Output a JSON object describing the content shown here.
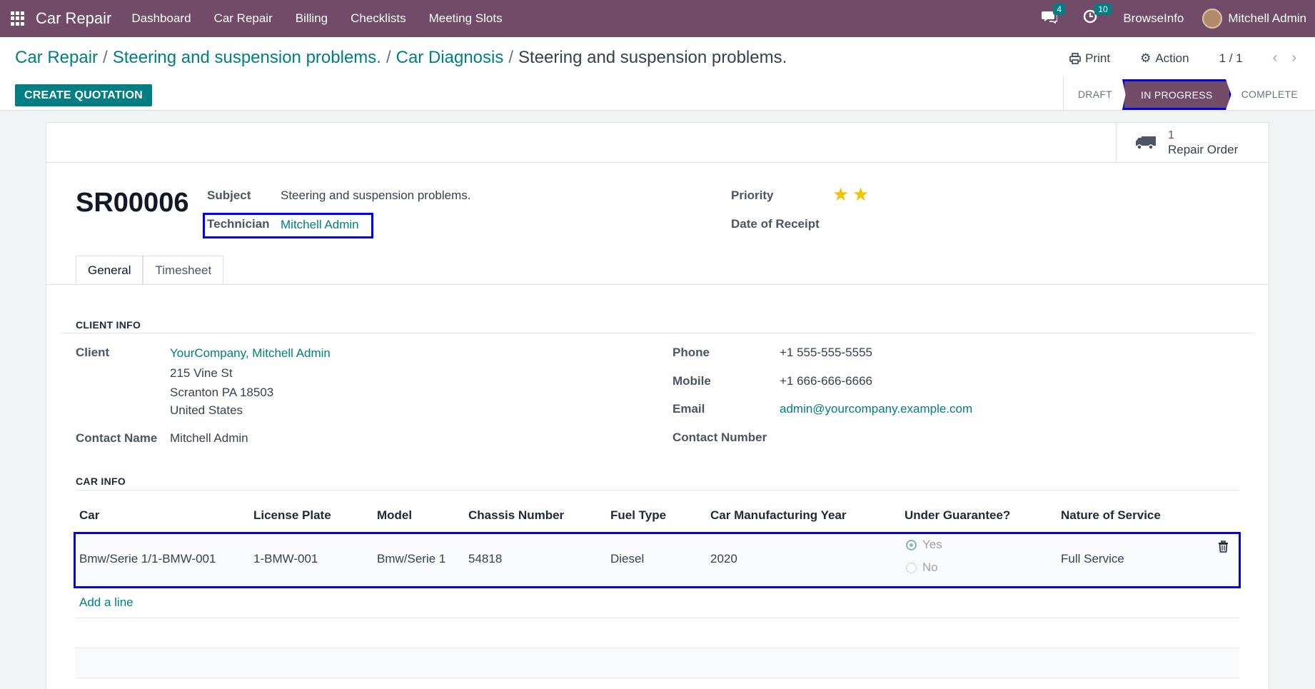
{
  "navbar": {
    "app_name": "Car Repair",
    "menu": [
      "Dashboard",
      "Car Repair",
      "Billing",
      "Checklists",
      "Meeting Slots"
    ],
    "messages_count": "4",
    "activities_count": "10",
    "company": "BrowseInfo",
    "user": "Mitchell Admin"
  },
  "breadcrumb": {
    "items": [
      "Car Repair",
      "Steering and suspension problems.",
      "Car Diagnosis"
    ],
    "current": "Steering and suspension problems."
  },
  "actions": {
    "print": "Print",
    "action": "Action",
    "pager": "1 / 1",
    "create_quotation": "CREATE QUOTATION"
  },
  "status": {
    "steps": [
      "DRAFT",
      "IN PROGRESS",
      "COMPLETE"
    ],
    "active": "IN PROGRESS"
  },
  "smart_button": {
    "count": "1",
    "label": "Repair Order"
  },
  "record": {
    "name": "SR00006",
    "subject_label": "Subject",
    "subject": "Steering and suspension problems.",
    "technician_label": "Technician",
    "technician": "Mitchell Admin",
    "priority_label": "Priority",
    "priority_stars": 2,
    "date_label": "Date of Receipt"
  },
  "tabs": [
    "General",
    "Timesheet"
  ],
  "client_info": {
    "title": "CLIENT INFO",
    "client_label": "Client",
    "client": "YourCompany, Mitchell Admin",
    "address1": "215 Vine St",
    "address2": "Scranton PA 18503",
    "address3": "United States",
    "contact_name_label": "Contact Name",
    "contact_name": "Mitchell Admin",
    "phone_label": "Phone",
    "phone": "+1 555-555-5555",
    "mobile_label": "Mobile",
    "mobile": "+1 666-666-6666",
    "email_label": "Email",
    "email": "admin@yourcompany.example.com",
    "contact_number_label": "Contact Number"
  },
  "car_info": {
    "title": "CAR INFO",
    "columns": [
      "Car",
      "License Plate",
      "Model",
      "Chassis Number",
      "Fuel Type",
      "Car Manufacturing Year",
      "Under Guarantee?",
      "Nature of Service"
    ],
    "row": {
      "car": "Bmw/Serie 1/1-BMW-001",
      "plate": "1-BMW-001",
      "model": "Bmw/Serie 1",
      "chassis": "54818",
      "fuel": "Diesel",
      "year": "2020",
      "guarantee_yes": "Yes",
      "guarantee_no": "No",
      "guarantee_selected": "Yes",
      "service": "Full Service"
    },
    "add_line": "Add a line"
  },
  "colors": {
    "brand": "#714b67",
    "accent": "#017e84",
    "highlight": "#0000ee",
    "star": "#f3c300"
  }
}
